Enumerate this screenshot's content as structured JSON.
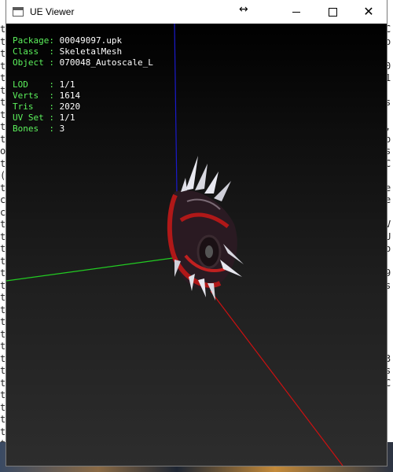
{
  "window": {
    "title": "UE Viewer",
    "resize_cursor_glyph": "↔",
    "close_glyph": "✕"
  },
  "info": {
    "package": {
      "label": "Package: ",
      "value": "00049097.upk"
    },
    "class": {
      "label": "Class  : ",
      "value": "SkeletalMesh"
    },
    "object": {
      "label": "Object : ",
      "value": "070048_Autoscale_L"
    },
    "lod": {
      "label": "LOD    : ",
      "value": "1/1"
    },
    "verts": {
      "label": "Verts  : ",
      "value": "1614"
    },
    "tris": {
      "label": "Tris   : ",
      "value": "2020"
    },
    "uvset": {
      "label": "UV Set : ",
      "value": "1/1"
    },
    "bones": {
      "label": "Bones  : ",
      "value": "3"
    }
  },
  "background_console": {
    "left_chars": [
      "t",
      "t",
      "t",
      "t",
      "t",
      "t",
      "t",
      "t",
      "t",
      "t",
      "o",
      "t",
      "(",
      "t",
      "c",
      "c",
      "t",
      "t",
      "t",
      "t",
      "t",
      "t",
      "t",
      "t",
      "t",
      "t",
      "t",
      "t",
      "t",
      "t",
      "t",
      "t",
      "t",
      "t",
      "t",
      "t"
    ],
    "right_chars": [
      "C",
      "o",
      "",
      "0",
      "1",
      "",
      "s",
      "",
      ",",
      "o",
      "s",
      "C",
      "",
      "e",
      "e",
      "",
      "V",
      "U",
      "o",
      "",
      "9",
      "s",
      "",
      "",
      "",
      "",
      "",
      "3",
      "s",
      "C",
      "",
      "",
      ""
    ]
  },
  "colors": {
    "info_label": "#5cf25c",
    "info_value": "#ffffff",
    "axis_x": "#cc1111",
    "axis_y": "#22cc22",
    "axis_z": "#1a1acc",
    "mesh_red": "#b01818",
    "mesh_dark": "#2a1a22",
    "spike": "#e8e8f0"
  }
}
